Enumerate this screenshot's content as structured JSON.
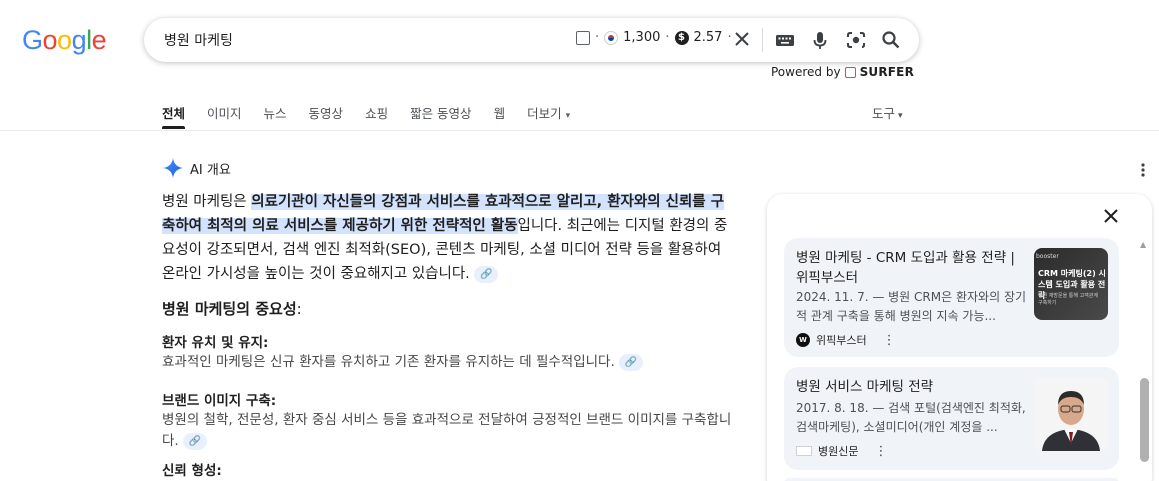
{
  "logo": {
    "letters": [
      "G",
      "o",
      "o",
      "g",
      "l",
      "e"
    ]
  },
  "search": {
    "query": "병원 마케팅"
  },
  "surfer_widget": {
    "volume": "1,300",
    "cpc": "2.57",
    "dot": "·"
  },
  "powered_by": {
    "prefix": "Powered by",
    "brand": "SURFER"
  },
  "tabs": [
    {
      "label": "전체",
      "active": true
    },
    {
      "label": "이미지"
    },
    {
      "label": "뉴스"
    },
    {
      "label": "동영상"
    },
    {
      "label": "쇼핑"
    },
    {
      "label": "짧은 동영상"
    },
    {
      "label": "웹"
    },
    {
      "label": "더보기"
    }
  ],
  "tools_label": "도구",
  "ai_overview": {
    "header": "AI 개요",
    "intro_plain_1": "병원 마케팅은 ",
    "intro_highlight": "의료기관이 자신들의 강점과 서비스를 효과적으로 알리고, 환자와의 신뢰를 구축하여 최적의 의료 서비스를 제공하기 위한 전략적인 활동",
    "intro_plain_2": "입니다. 최근에는 디지털 환경의 중요성이 강조되면서, 검색 엔진 최적화(SEO), 콘텐츠 마케팅, 소셜 미디어 전략 등을 활용하여 온라인 가시성을 높이는 것이 중요해지고 있습니다.",
    "section_title": "병원 마케팅의 중요성",
    "section_colon": ":",
    "items": [
      {
        "title": "환자 유치 및 유지:",
        "desc": "효과적인 마케팅은 신규 환자를 유치하고 기존 환자를 유지하는 데 필수적입니다."
      },
      {
        "title": "브랜드 이미지 구축:",
        "desc": "병원의 철학, 전문성, 환자 중심 서비스 등을 효과적으로 전달하여 긍정적인 브랜드 이미지를 구축합니다."
      },
      {
        "title": "신뢰 형성:",
        "desc": ""
      }
    ]
  },
  "sources": [
    {
      "title": "병원 마케팅 - CRM 도입과 활용 전략 | 위픽부스터",
      "snippet": "2024. 11. 7. — 병원 CRM은 환자와의 장기적 관계 구축을 통해 병원의 지속 가능...",
      "site": "위픽부스터",
      "badge": "W",
      "thumb_text_top": "booster",
      "thumb_text_main": "CRM 마케팅(2) 시스템 도입과 활용 전략",
      "thumb_text_sub": "병원 재방문을 통해 고객관계 구축하기"
    },
    {
      "title": "병원 서비스 마케팅 전략",
      "snippet": "2017. 8. 18. — 검색 포털(검색엔진 최적화, 검색마케팅), 소셜미디어(개인 계정을 ...",
      "site": "병원신문",
      "badge": "병원신문"
    }
  ]
}
